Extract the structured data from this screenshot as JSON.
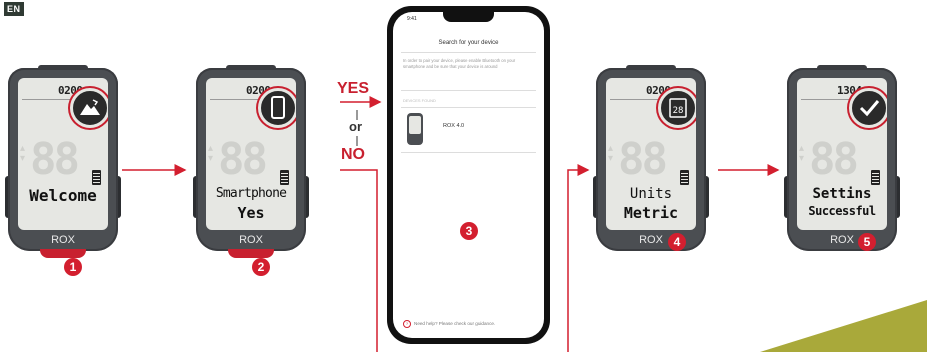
{
  "lang_tag": "EN",
  "devices": [
    {
      "time": "0200",
      "line1": "",
      "line2": "Welcome",
      "label": "ROX",
      "step": "1",
      "icon": "mountain-icon"
    },
    {
      "time": "0200",
      "line1": "Smartphone",
      "line2": "Yes",
      "label": "ROX",
      "step": "2",
      "icon": "phone-icon"
    },
    {
      "time": "0200",
      "line1": "Units",
      "line2": "Metric",
      "label": "ROX",
      "step": "4",
      "icon": "calendar-icon"
    },
    {
      "time": "1304",
      "line1": "Settins",
      "line2": "Successful",
      "label": "ROX",
      "step": "5",
      "icon": "checkmark-icon"
    }
  ],
  "decision": {
    "yes": "YES",
    "or": "or",
    "no": "NO"
  },
  "phone": {
    "status_time": "9:41",
    "title": "Search for your device",
    "instruction": "In order to pair your device, please enable Bluetooth on your smartphone and be sure that your device is around",
    "section": "DEVICES FOUND",
    "device_name": "ROX 4.0",
    "help": "Need help? Please check our guidance.",
    "step": "3"
  },
  "colors": {
    "accent": "#d31f2f",
    "device_body": "#4b4e52",
    "screen": "#e6e7e3",
    "olive": "#a9a93a"
  }
}
